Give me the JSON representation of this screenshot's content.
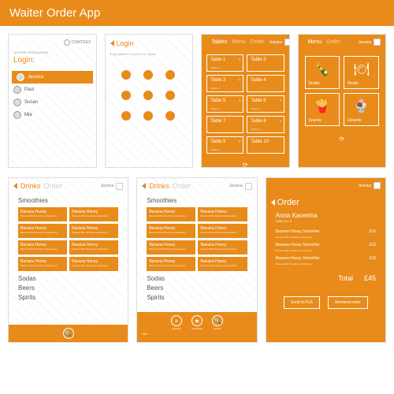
{
  "app_title": "Waiter Order App",
  "brand": "COMTREX",
  "restaurant": "OXFORD RESTAURANT",
  "login": {
    "title": "Login:",
    "users": [
      "Jessica",
      "Paul",
      "Susan",
      "Mia"
    ]
  },
  "pattern": {
    "title": "Login",
    "hint": "Draw pattern on screen to unlock"
  },
  "user": "Jessica",
  "tables": {
    "tabs": [
      "Tables",
      "Menu",
      "Order"
    ],
    "items": [
      {
        "n": "Table 1",
        "s": "Orders: 2"
      },
      {
        "n": "Table 2",
        "s": ""
      },
      {
        "n": "Table 3",
        "s": "Orders: 2"
      },
      {
        "n": "Table 4",
        "s": ""
      },
      {
        "n": "Table 5",
        "s": "Orders: 2"
      },
      {
        "n": "Table 6",
        "s": "Orders: 2"
      },
      {
        "n": "Table 7",
        "s": ""
      },
      {
        "n": "Table 8",
        "s": "Orders: 2"
      },
      {
        "n": "Table 9",
        "s": "Orders: 2"
      },
      {
        "n": "Table 10",
        "s": ""
      }
    ]
  },
  "menu": {
    "tabs": [
      "Menu",
      "Order"
    ],
    "tiles": [
      {
        "l": "Drinks",
        "i": "🍾"
      },
      {
        "l": "Meals",
        "i": "🍽"
      },
      {
        "l": "Snacks",
        "i": "🍟"
      },
      {
        "l": "Deserts",
        "i": "🍨"
      }
    ]
  },
  "drinks": {
    "tab_main": "Drinks",
    "tab_dim": "Order",
    "cat": "Smoothies",
    "item_name": "Banana Honey",
    "item_desc": "Banana Milk Strawberry Raspberry",
    "others": [
      "Sodas",
      "Beers",
      "Spirits"
    ],
    "bar_icons": [
      {
        "l": "Expand",
        "g": "+"
      },
      {
        "l": "Favourites",
        "g": "★"
      },
      {
        "l": "Search",
        "g": "🔍"
      }
    ],
    "info": "Info"
  },
  "order": {
    "title": "Order",
    "customer": "Anna Kanerina",
    "table": "Table No. 8",
    "lines": [
      {
        "n": "Banana Honey Smoothie",
        "d": "Banana Milk Strawberry Raspberry",
        "p": "£15"
      },
      {
        "n": "Banana Honey Smoothie",
        "d": "Banana Milk Strawberry Raspberry",
        "p": "£15"
      },
      {
        "n": "Banana Honey Smoothie",
        "d": "Banana Milk Strawberry Raspberry",
        "p": "£15"
      }
    ],
    "total_label": "Total",
    "total": "£45",
    "btn1": "Send to PoS",
    "btn2": "Ammend order"
  }
}
